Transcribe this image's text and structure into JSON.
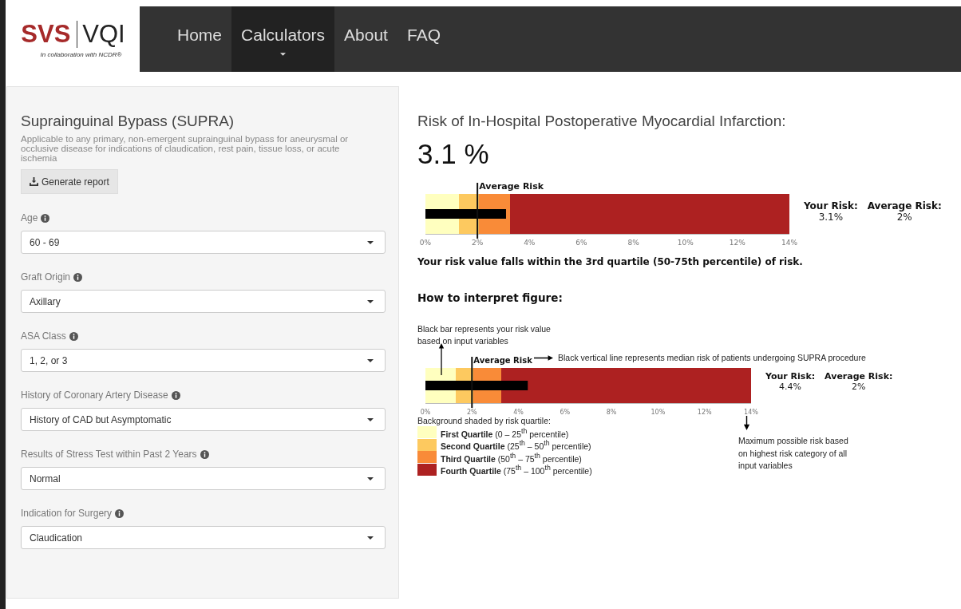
{
  "navbar": {
    "logo": {
      "brand": "SVS",
      "product": "VQI",
      "tagline": "In collaboration with NCDR®"
    },
    "items": [
      {
        "label": "Home",
        "selected": false,
        "dropdown": false
      },
      {
        "label": "Calculators",
        "selected": true,
        "dropdown": true
      },
      {
        "label": "About",
        "selected": false,
        "dropdown": false
      },
      {
        "label": "FAQ",
        "selected": false,
        "dropdown": false
      }
    ]
  },
  "form": {
    "title": "Suprainguinal Bypass (SUPRA)",
    "description": "Applicable to any primary, non-emergent suprainguinal bypass for aneurysmal or occlusive disease for indications of claudication, rest pain, tissue loss, or acute ischemia",
    "report_button": "Generate report",
    "fields": [
      {
        "label": "Age",
        "value": "60 - 69"
      },
      {
        "label": "Graft Origin",
        "value": "Axillary"
      },
      {
        "label": "ASA Class",
        "value": "1, 2, or 3"
      },
      {
        "label": "History of Coronary Artery Disease",
        "value": "History of CAD but Asymptomatic"
      },
      {
        "label": "Results of Stress Test within Past 2 Years",
        "value": "Normal"
      },
      {
        "label": "Indication for Surgery",
        "value": "Claudication"
      }
    ]
  },
  "result": {
    "heading": "Risk of In-Hospital Postoperative Myocardial Infarction:",
    "value": "3.1 %",
    "chart": {
      "chart_data": {
        "type": "bar",
        "orientation": "horizontal",
        "series": [
          {
            "name": "Your Risk:",
            "color": "#000000",
            "values": [
              3.1
            ]
          }
        ],
        "ref_lines": [
          {
            "axis": "x",
            "value": 2,
            "label": "Average Risk"
          }
        ],
        "xlim": [
          0,
          14
        ],
        "xticks": [
          {
            "value": 0,
            "label": "0%"
          },
          {
            "value": 2,
            "label": "2%"
          },
          {
            "value": 4,
            "label": "4%"
          },
          {
            "value": 6,
            "label": "6%"
          },
          {
            "value": 8,
            "label": "8%"
          },
          {
            "value": 10,
            "label": "10%"
          },
          {
            "value": 12,
            "label": "12%"
          },
          {
            "value": 14,
            "label": "14%"
          }
        ]
      }
    },
    "your_risk": "3.1%",
    "average_risk_label": "Average Risk:",
    "average_risk": "2%",
    "summary": "Your risk value falls within the 3rd quartile (50-75th percentile) of risk."
  },
  "interpret": {
    "heading": "How to interpret figure:",
    "bar_note": "Black bar represents your risk value based on input variables",
    "line_note": "Black vertical line represents median risk of patients undergoing SUPRA procedure",
    "chart": {
      "chart_data": {
        "type": "bar",
        "orientation": "horizontal",
        "series": [
          {
            "name": "Your Risk:",
            "color": "#000000",
            "values": [
              4.4
            ]
          }
        ],
        "ref_lines": [
          {
            "axis": "x",
            "value": 2,
            "label": "Average Risk"
          }
        ],
        "xlim": [
          0,
          14
        ],
        "xticks": [
          {
            "value": 0,
            "label": "0%"
          },
          {
            "value": 2,
            "label": "2%"
          },
          {
            "value": 4,
            "label": "4%"
          },
          {
            "value": 6,
            "label": "6%"
          },
          {
            "value": 8,
            "label": "8%"
          },
          {
            "value": 10,
            "label": "10%"
          },
          {
            "value": 12,
            "label": "12%"
          },
          {
            "value": 14,
            "label": "14%"
          }
        ]
      }
    },
    "your_risk": "4.4%",
    "average_risk_label": "Average Risk:",
    "average_risk": "2%",
    "legend_title": "Background shaded by risk quartile:",
    "legend": [
      {
        "color": "#ffffbf",
        "label": "**First Quartile** (0 – 25$^{th}$ percentile)"
      },
      {
        "color": "#fdc95f",
        "label": "**Second Quartile** (25$^{th}$ – 50$^{th}$ percentile)"
      },
      {
        "color": "#f98b38",
        "label": "**Third Quartile** (50$^{th}$ – 75$^{th}$ percentile)"
      },
      {
        "color": "#ad2121",
        "label": "**Fourth Quartile** (75$^{th}$ – 100$^{th}$ percentile)"
      }
    ],
    "max_note": "Maximum possible risk based on highest risk category of all input variables"
  }
}
